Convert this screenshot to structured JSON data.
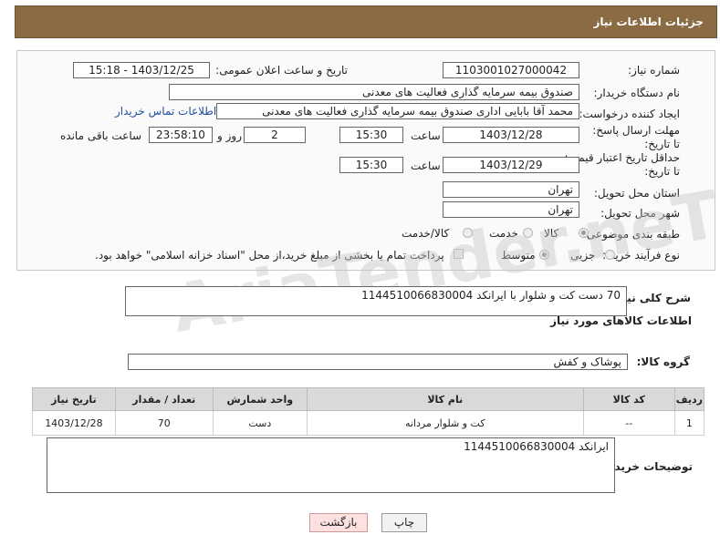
{
  "header": {
    "title": "جزئیات اطلاعات نیاز"
  },
  "form": {
    "need_number_label": "شماره نیاز:",
    "need_number": "1103001027000042",
    "announce_label": "تاریخ و ساعت اعلان عمومی:",
    "announce_value": "1403/12/25 - 15:18",
    "buyer_org_label": "نام دستگاه خریدار:",
    "buyer_org": "صندوق بیمه سرمایه گذاری فعالیت های معدنی",
    "creator_label": "ایجاد کننده درخواست:",
    "creator": "محمد آقا بابایی اداری صندوق بیمه سرمایه گذاری فعالیت های معدنی",
    "contact_link": "اطلاعات تماس خریدار",
    "deadline_label": "مهلت ارسال پاسخ: تا تاریخ:",
    "deadline_date": "1403/12/28",
    "time_label": "ساعت",
    "deadline_time": "15:30",
    "days_count": "2",
    "days_label": "روز و",
    "remaining_time": "23:58:10",
    "remaining_label": "ساعت باقی مانده",
    "validity_label": "حداقل تاریخ اعتبار قیمت: تا تاریخ:",
    "validity_date": "1403/12/29",
    "validity_time": "15:30",
    "province_label": "استان محل تحویل:",
    "province": "تهران",
    "city_label": "شهر محل تحویل:",
    "city": "تهران",
    "category_label": "طبقه بندی موضوعی:",
    "category_options": [
      "کالا",
      "خدمت",
      "کالا/خدمت"
    ],
    "process_label": "نوع فرآیند خرید :",
    "process_options": [
      "جزیی",
      "متوسط"
    ],
    "payment_note": "پرداخت تمام یا بخشی از مبلغ خرید،از محل \"اسناد خزانه اسلامی\" خواهد بود."
  },
  "description": {
    "label": "شرح کلی نیاز:",
    "value": "70 دست کت و شلوار با ایرانکد 1144510066830004"
  },
  "goods_section": {
    "title": "اطلاعات کالاهای مورد نیاز",
    "group_label": "گروه کالا:",
    "group_value": "پوشاک و کفش",
    "columns": [
      "ردیف",
      "کد کالا",
      "نام کالا",
      "واحد شمارش",
      "تعداد / مقدار",
      "تاریخ نیاز"
    ],
    "rows": [
      [
        "1",
        "--",
        "کت و شلوار مردانه",
        "دست",
        "70",
        "1403/12/28"
      ]
    ]
  },
  "buyer_notes": {
    "label": "توضیحات خریدار:",
    "value": "ایرانکد 1144510066830004"
  },
  "buttons": {
    "print": "چاپ",
    "back": "بازگشت"
  },
  "watermark": "AriaTender.neT"
}
